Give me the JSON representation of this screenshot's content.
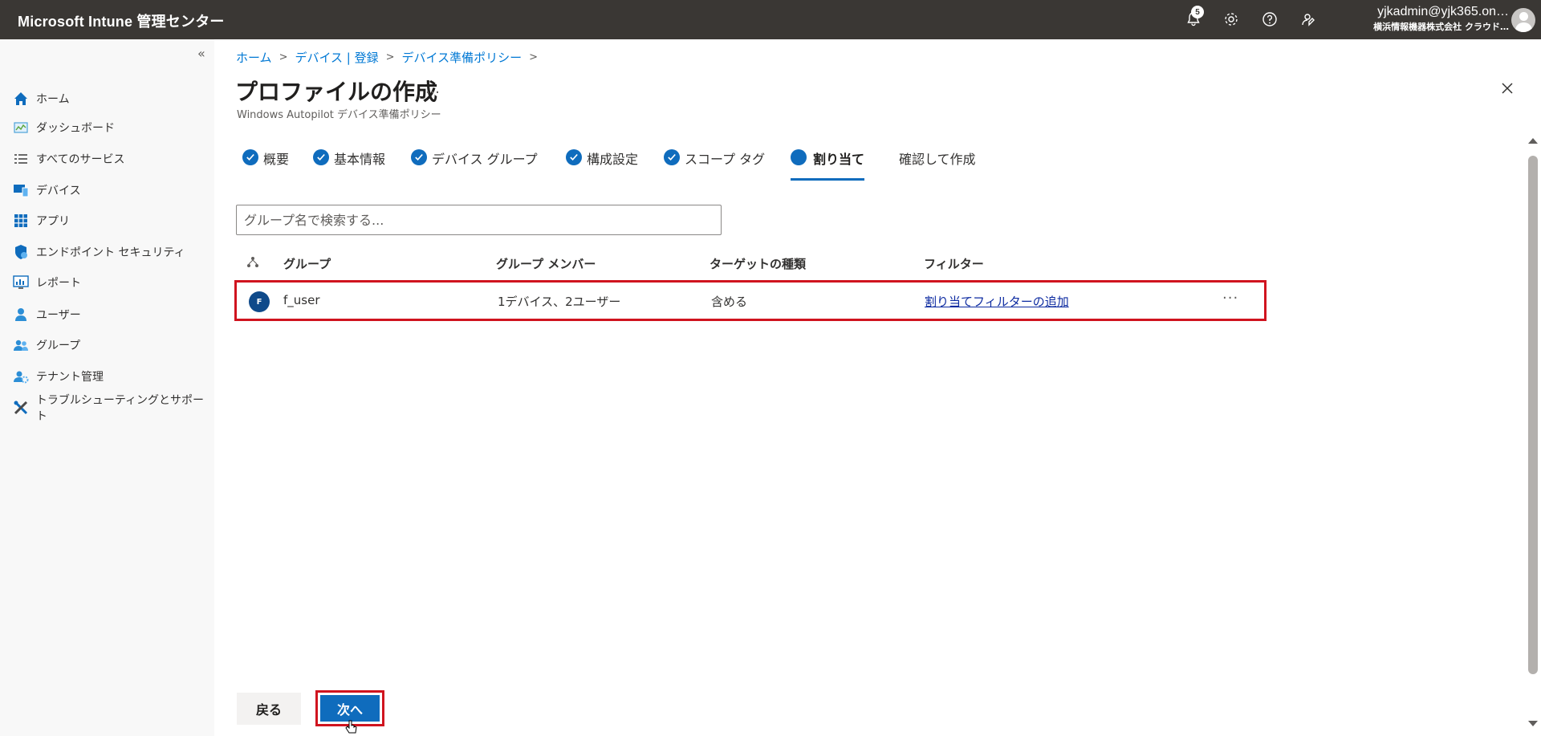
{
  "app": {
    "title": "Microsoft Intune 管理センター",
    "notification_count": "5",
    "account_email": "yjkadmin@yjk365.on…",
    "account_tenant": "横浜情報機器株式会社 クラウド…"
  },
  "sidebar": {
    "collapse_label": "«",
    "items": [
      {
        "label": "ホーム",
        "icon": "home-icon"
      },
      {
        "label": "ダッシュボード",
        "icon": "dashboard-icon"
      },
      {
        "label": "すべてのサービス",
        "icon": "list-icon"
      },
      {
        "label": "デバイス",
        "icon": "device-icon"
      },
      {
        "label": "アプリ",
        "icon": "apps-grid-icon"
      },
      {
        "label": "エンドポイント セキュリティ",
        "icon": "shield-icon"
      },
      {
        "label": "レポート",
        "icon": "report-icon"
      },
      {
        "label": "ユーザー",
        "icon": "user-icon"
      },
      {
        "label": "グループ",
        "icon": "group-icon"
      },
      {
        "label": "テナント管理",
        "icon": "tenant-icon"
      },
      {
        "label": "トラブルシューティングとサポート",
        "icon": "tools-icon"
      }
    ]
  },
  "breadcrumb": [
    "ホーム",
    "デバイス | 登録",
    "デバイス準備ポリシー"
  ],
  "page": {
    "title": "プロファイルの作成",
    "more": "…",
    "subtitle": "Windows Autopilot デバイス準備ポリシー"
  },
  "tabs": [
    {
      "label": "概要",
      "state": "done"
    },
    {
      "label": "基本情報",
      "state": "done"
    },
    {
      "label": "デバイス グループ",
      "state": "done"
    },
    {
      "label": "構成設定",
      "state": "done"
    },
    {
      "label": "スコープ タグ",
      "state": "done"
    },
    {
      "label": "割り当て",
      "state": "active"
    },
    {
      "label": "確認して作成",
      "state": "pending"
    }
  ],
  "search": {
    "placeholder": "グループ名で検索する..."
  },
  "table": {
    "columns": [
      "グループ",
      "グループ メンバー",
      "ターゲットの種類",
      "フィルター"
    ],
    "rows": [
      {
        "avatar": "F",
        "group": "f_user",
        "members": "1デバイス、2ユーザー",
        "target": "含める",
        "filter": "割り当てフィルターの追加",
        "more": "···"
      }
    ]
  },
  "footer": {
    "back_label": "戻る",
    "next_label": "次へ"
  },
  "colors": {
    "accent": "#0f6cbd",
    "highlight": "#d0141f",
    "topbar": "#3a3734"
  }
}
